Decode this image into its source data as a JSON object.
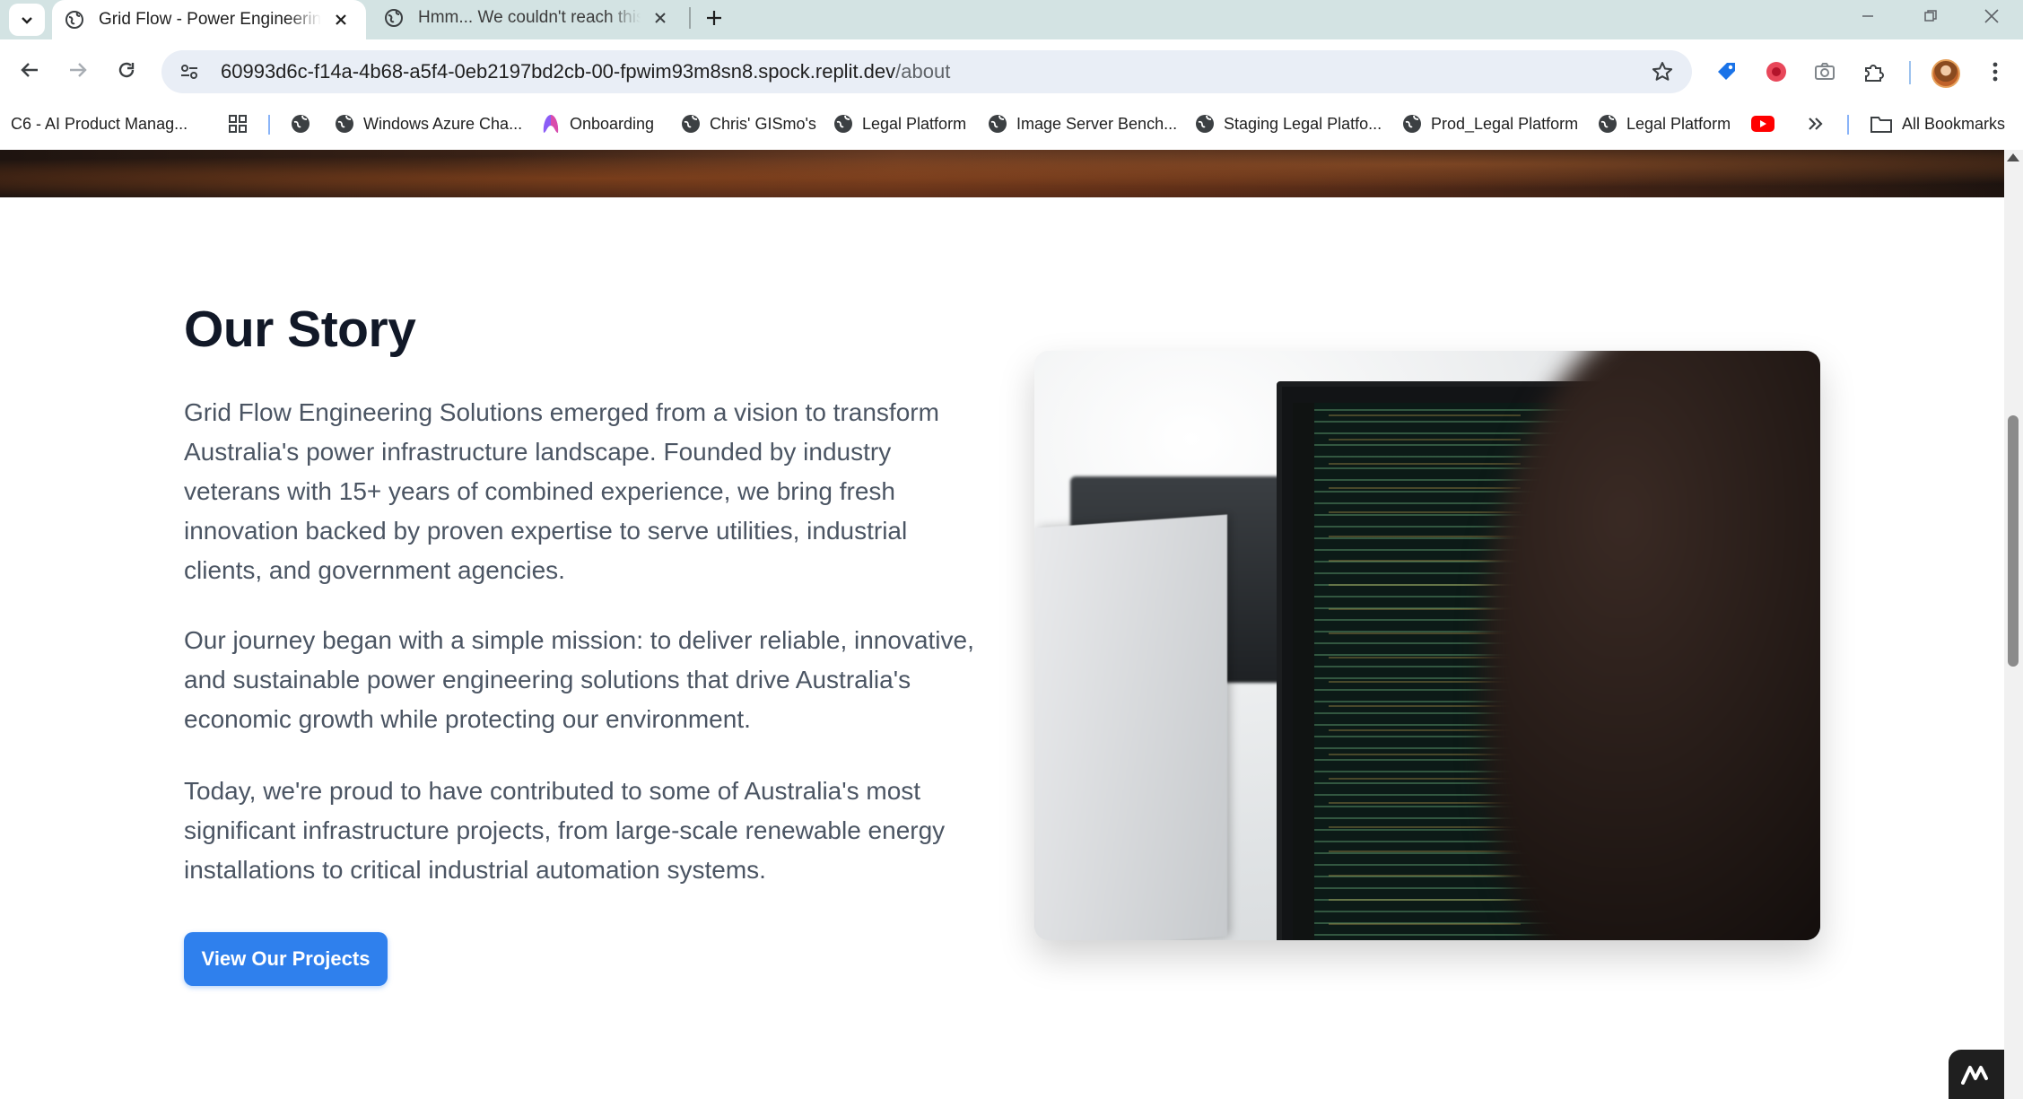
{
  "browser": {
    "tabs": [
      {
        "title": "Grid Flow - Power Engineering Solutions",
        "active": true
      },
      {
        "title": "Hmm... We couldn't reach this app",
        "active": false
      }
    ],
    "url": {
      "host": "60993d6c-f14a-4b68-a5f4-0eb2197bd2cb-00-fpwim93m8sn8.spock.replit.dev",
      "path": "/about"
    },
    "bookmarks": [
      "C6 - AI Product Manag...",
      "Windows Azure Cha...",
      "Onboarding",
      "Chris' GISmo's",
      "Legal Platform",
      "Image Server Bench...",
      "Staging Legal Platfo...",
      "Prod_Legal Platform",
      "Legal Platform"
    ],
    "all_bookmarks_label": "All Bookmarks"
  },
  "page": {
    "heading": "Our Story",
    "paragraphs": [
      "Grid Flow Engineering Solutions emerged from a vision to transform Australia's power infrastructure landscape. Founded by industry veterans with 15+ years of combined experience, we bring fresh innovation backed by proven expertise to serve utilities, industrial clients, and government agencies.",
      "Our journey began with a simple mission: to deliver reliable, innovative, and sustainable power engineering solutions that drive Australia's economic growth while protecting our environment.",
      "Today, we're proud to have contributed to some of Australia's most significant infrastructure projects, from large-scale renewable energy installations to critical industrial automation systems."
    ],
    "cta_label": "View Our Projects"
  },
  "colors": {
    "accent": "#2f80ed",
    "heading": "#111827",
    "body_text": "#4b5563",
    "tabstrip": "#d3e3e3"
  }
}
